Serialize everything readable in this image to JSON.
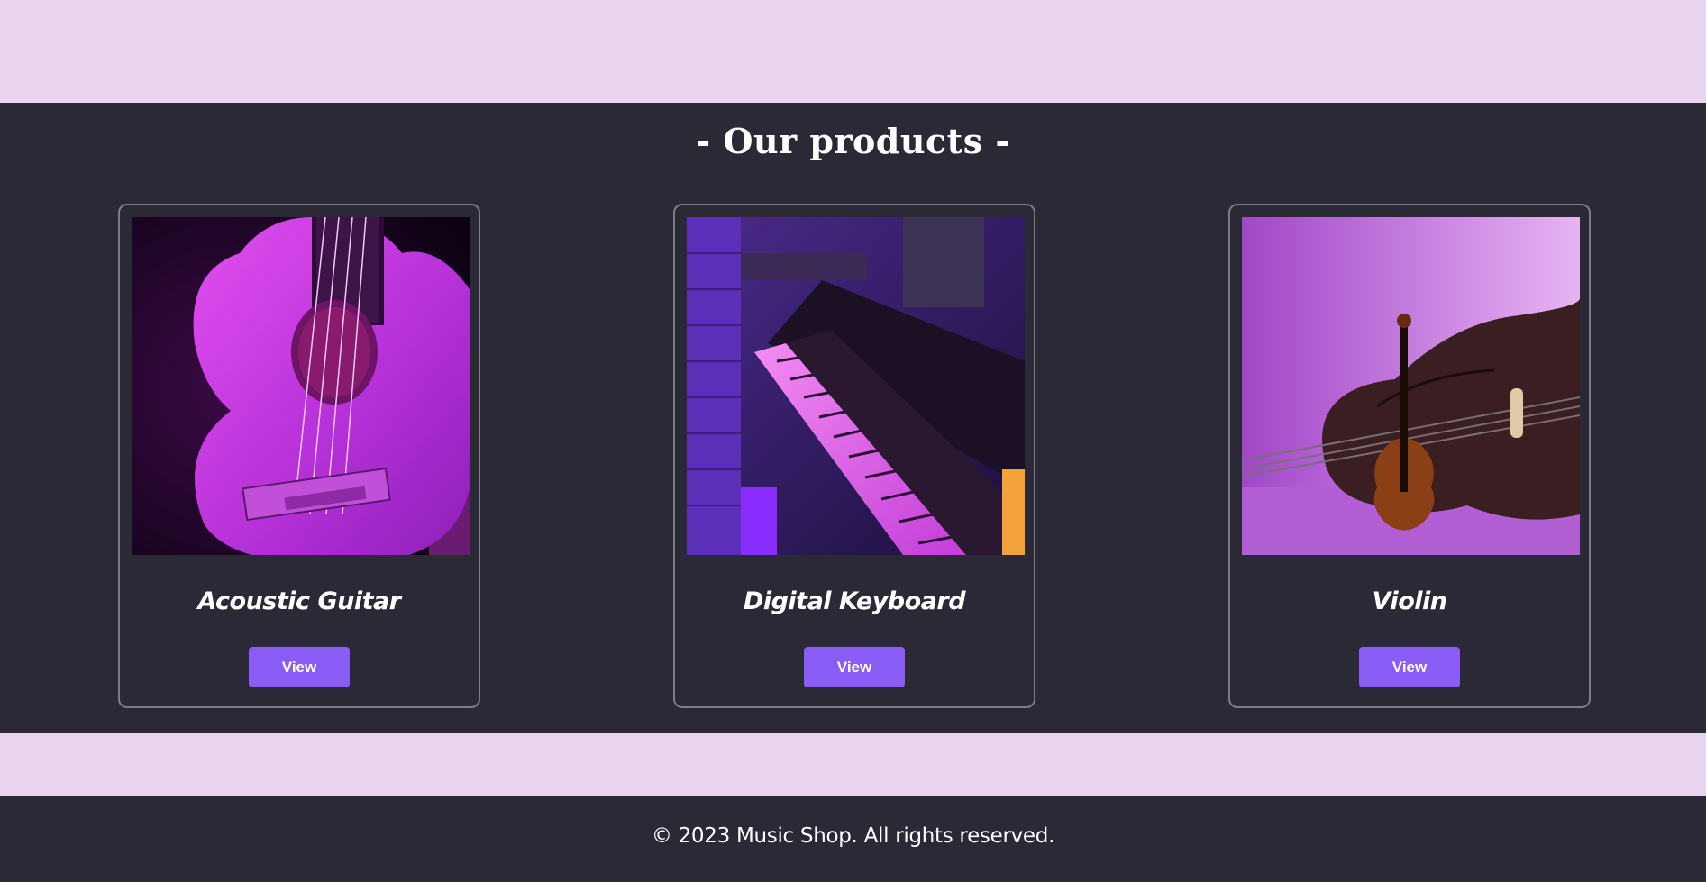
{
  "products_section": {
    "title": "- Our products -"
  },
  "products": [
    {
      "name": "Acoustic Guitar",
      "button_label": "View",
      "image": "acoustic-guitar-photo"
    },
    {
      "name": "Digital Keyboard",
      "button_label": "View",
      "image": "digital-keyboard-photo"
    },
    {
      "name": "Violin",
      "button_label": "View",
      "image": "violin-photo"
    }
  ],
  "footer": {
    "copyright": "© 2023 Music Shop. All rights reserved."
  },
  "colors": {
    "page_background": "#e8d4ee",
    "section_background": "#2a2935",
    "button_accent": "#8a5cf6",
    "card_border": "#7d7c86",
    "text": "#ffffff"
  }
}
